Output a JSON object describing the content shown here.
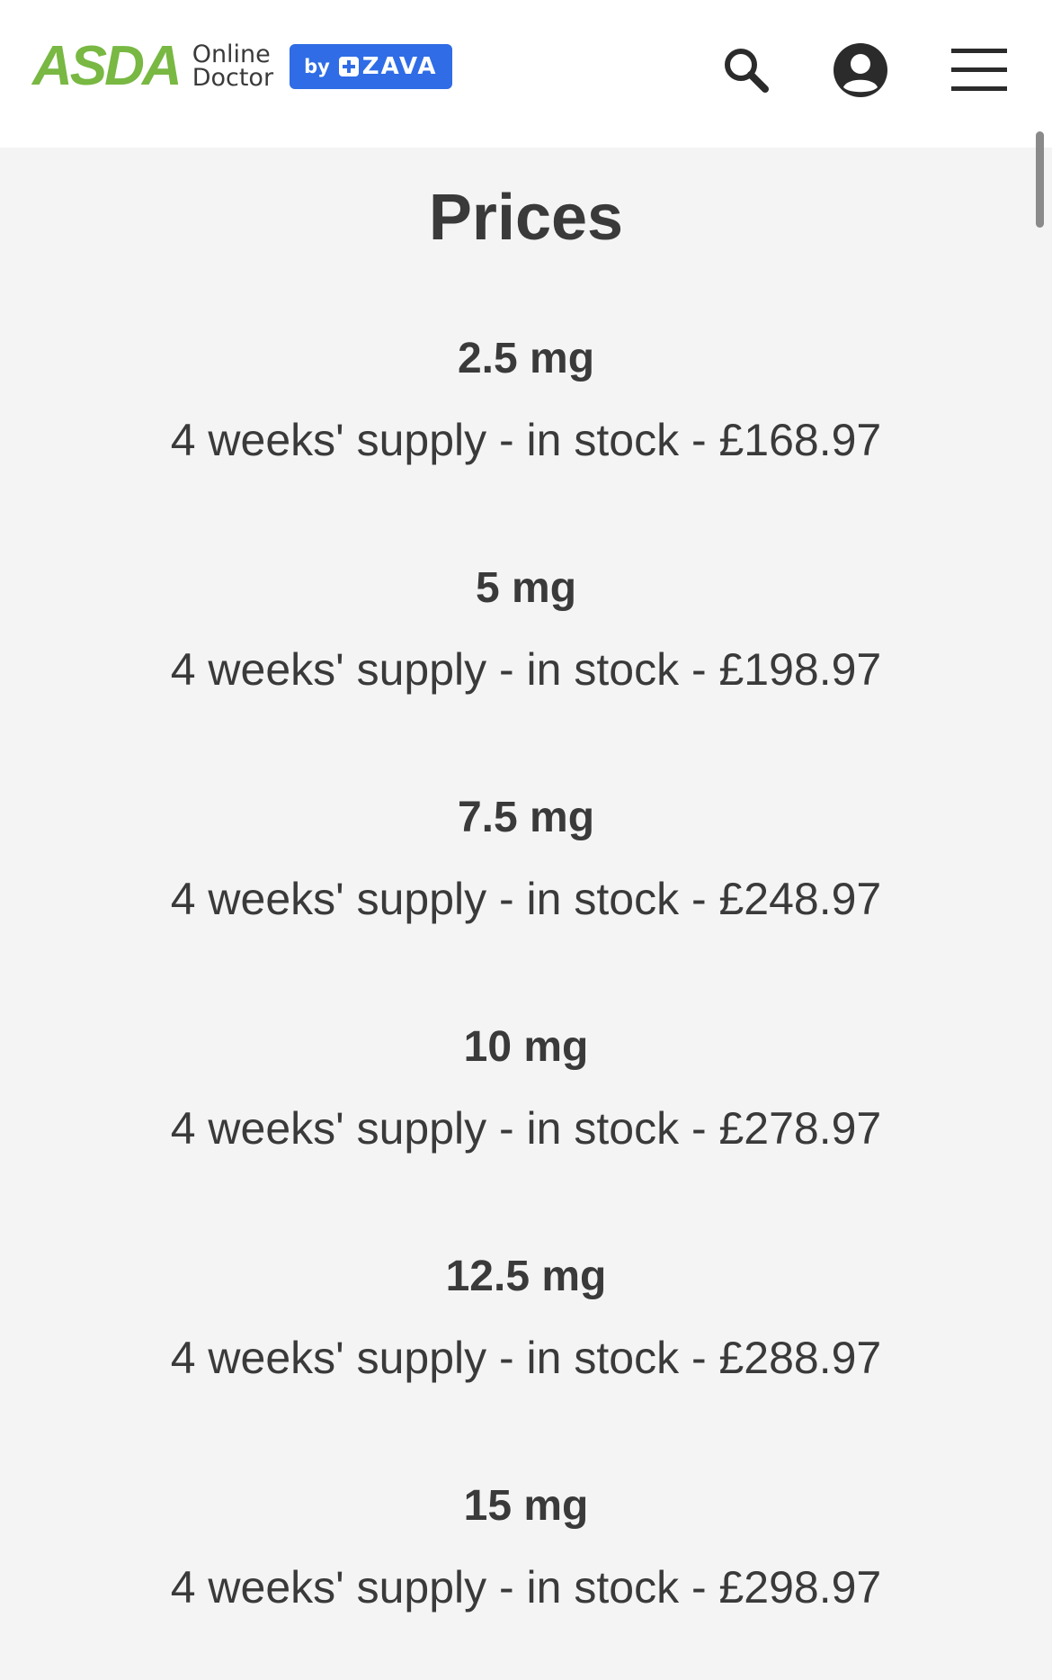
{
  "header": {
    "logo_brand": "ASDA",
    "logo_line1": "Online",
    "logo_line2": "Doctor",
    "badge_by": "by",
    "badge_name": "ZAVA",
    "brand_green": "#78b843",
    "badge_blue": "#2f6ce5",
    "icons": [
      "search-icon",
      "account-icon",
      "menu-icon"
    ]
  },
  "main": {
    "title": "Prices",
    "prices": [
      {
        "dose": "2.5 mg",
        "detail": "4 weeks' supply - in stock - £168.97"
      },
      {
        "dose": "5 mg",
        "detail": "4 weeks' supply - in stock - £198.97"
      },
      {
        "dose": "7.5 mg",
        "detail": "4 weeks' supply - in stock - £248.97"
      },
      {
        "dose": "10 mg",
        "detail": "4 weeks' supply - in stock - £278.97"
      },
      {
        "dose": "12.5 mg",
        "detail": "4 weeks' supply - in stock - £288.97"
      },
      {
        "dose": "15 mg",
        "detail": "4 weeks' supply - in stock - £298.97"
      }
    ]
  }
}
